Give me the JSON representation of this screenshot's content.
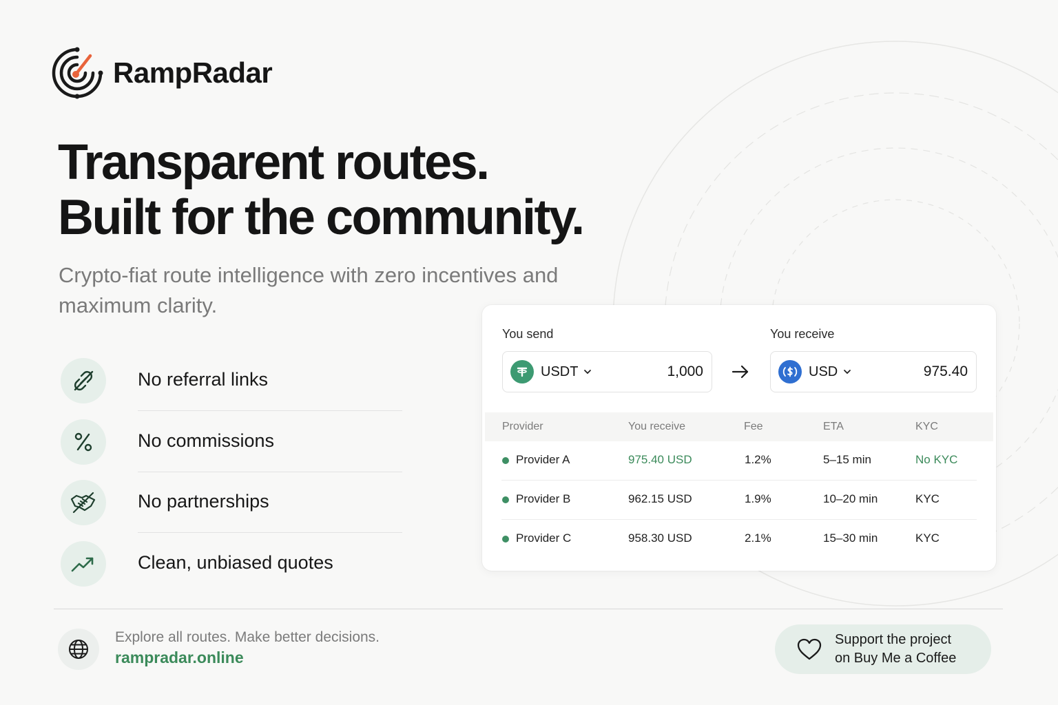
{
  "brand": {
    "name": "RampRadar",
    "accent": "#e8633b",
    "green": "#3b8a5a"
  },
  "hero": {
    "line1": "Transparent routes.",
    "line2": "Built for the community.",
    "subtitle": "Crypto-fiat route intelligence with zero incentives and maximum clarity."
  },
  "features": [
    {
      "label": "No referral links",
      "icon": "broken-link-icon"
    },
    {
      "label": "No commissions",
      "icon": "percent-icon"
    },
    {
      "label": "No partnerships",
      "icon": "crossed-handshake-icon"
    },
    {
      "label": "Clean, unbiased quotes",
      "icon": "trend-up-icon"
    }
  ],
  "quote": {
    "send_label": "You send",
    "receive_label": "You receive",
    "send": {
      "ticker": "USDT",
      "amount": "1,000",
      "icon": "tether-icon"
    },
    "receive": {
      "ticker": "USD",
      "amount": "975.40",
      "icon": "usd-coin-icon"
    },
    "columns": [
      "Provider",
      "You receive",
      "Fee",
      "ETA",
      "KYC"
    ],
    "rows": [
      {
        "provider": "Provider A",
        "receive": "975.40 USD",
        "fee": "1.2%",
        "eta": "5–15 min",
        "kyc": "No KYC",
        "highlight": true
      },
      {
        "provider": "Provider B",
        "receive": "962.15 USD",
        "fee": "1.9%",
        "eta": "10–20 min",
        "kyc": "KYC",
        "highlight": false
      },
      {
        "provider": "Provider C",
        "receive": "958.30 USD",
        "fee": "2.1%",
        "eta": "15–30 min",
        "kyc": "KYC",
        "highlight": false
      }
    ]
  },
  "footer": {
    "tagline": "Explore all routes. Make better decisions.",
    "url": "rampradar.online",
    "support_line1": "Support the project",
    "support_line2": "on Buy Me a Coffee"
  }
}
